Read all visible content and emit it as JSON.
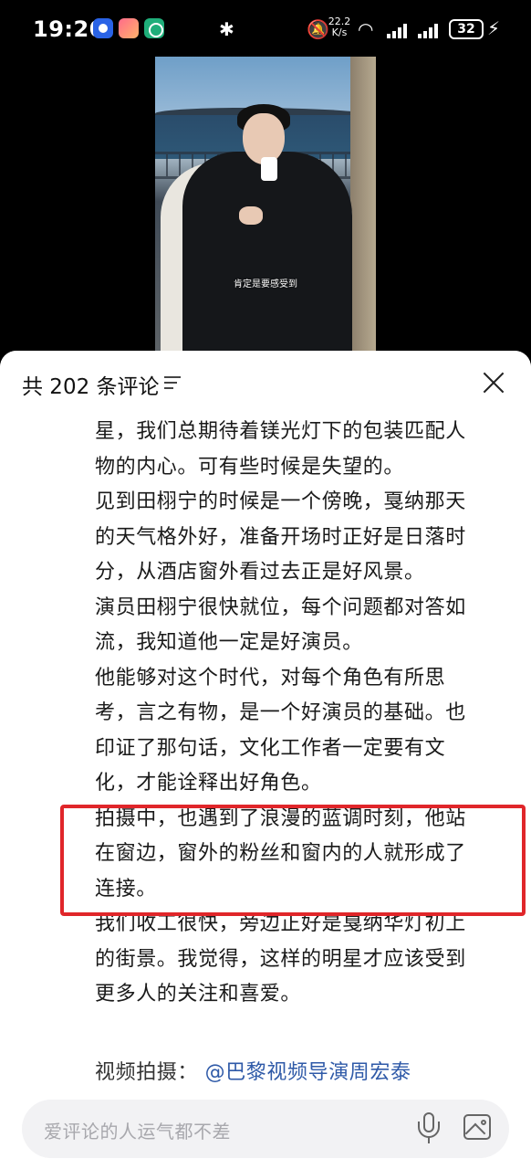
{
  "status_bar": {
    "time": "19:20",
    "net_speed_value": "22.2",
    "net_speed_unit": "K/s",
    "battery": "32"
  },
  "video": {
    "subtitle": "肯定是要感受到"
  },
  "comments_panel": {
    "title": "共 202 条评论",
    "lines": [
      "星，我们总期待着镁光灯下的包装匹配人",
      "物的内心。可有些时候是失望的。",
      "见到田栩宁的时候是一个傍晚，戛纳那天",
      "的天气格外好，准备开场时正好是日落时",
      "分，从酒店窗外看过去正是好风景。",
      "演员田栩宁很快就位，每个问题都对答如",
      "流，我知道他一定是好演员。",
      "他能够对这个时代，对每个角色有所思",
      "考，言之有物，是一个好演员的基础。也",
      "印证了那句话，文化工作者一定要有文",
      "化，才能诠释出好角色。",
      "拍摄中，也遇到了浪漫的蓝调时刻，他站",
      "在窗边，窗外的粉丝和窗内的人就形成了",
      "连接。",
      "我们收工很快，旁边正好是戛纳华灯初上",
      "的街景。我觉得，这样的明星才应该受到",
      "更多人的关注和喜爱。"
    ],
    "credit_label": "视频拍摄：",
    "credit_mention": "@巴黎视频导演周宏泰",
    "input_placeholder": "爱评论的人运气都不差",
    "highlight_color": "#e0262a"
  }
}
